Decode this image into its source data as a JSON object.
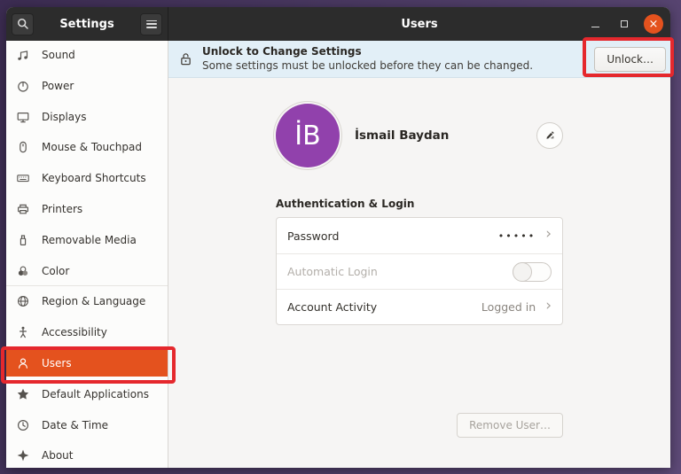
{
  "titlebar": {
    "app_title": "Settings",
    "page_title": "Users",
    "close_glyph": "×"
  },
  "sidebar": {
    "items": [
      {
        "label": "Sound",
        "icon": "sound-icon"
      },
      {
        "label": "Power",
        "icon": "power-icon"
      },
      {
        "label": "Displays",
        "icon": "displays-icon"
      },
      {
        "label": "Mouse & Touchpad",
        "icon": "mouse-icon"
      },
      {
        "label": "Keyboard Shortcuts",
        "icon": "keyboard-icon"
      },
      {
        "label": "Printers",
        "icon": "printer-icon"
      },
      {
        "label": "Removable Media",
        "icon": "removable-media-icon"
      },
      {
        "label": "Color",
        "icon": "color-icon"
      },
      {
        "label": "Region & Language",
        "icon": "globe-icon",
        "separator_before": true
      },
      {
        "label": "Accessibility",
        "icon": "accessibility-icon"
      },
      {
        "label": "Users",
        "icon": "users-icon",
        "selected": true,
        "highlighted": true
      },
      {
        "label": "Default Applications",
        "icon": "star-icon"
      },
      {
        "label": "Date & Time",
        "icon": "clock-icon"
      },
      {
        "label": "About",
        "icon": "four-point-star-icon"
      }
    ]
  },
  "banner": {
    "title": "Unlock to Change Settings",
    "subtitle": "Some settings must be unlocked before they can be changed.",
    "unlock_label": "Unlock…",
    "icon": "lock-icon",
    "highlighted": "unlock_button"
  },
  "user": {
    "initials": "İB",
    "name": "İsmail Baydan"
  },
  "auth": {
    "section_title": "Authentication & Login",
    "rows": [
      {
        "label": "Password",
        "value": "•••••",
        "chevron": "›",
        "type": "navigation"
      },
      {
        "label": "Automatic Login",
        "type": "toggle",
        "state": "off",
        "disabled": true
      },
      {
        "label": "Account Activity",
        "value": "Logged in",
        "chevron": "›",
        "type": "navigation"
      }
    ]
  },
  "actions": {
    "remove_user_label": "Remove User…"
  },
  "icons": {
    "search": "magnifier",
    "menu": "hamburger",
    "minimize": "thin-bar",
    "maximize": "square-outline",
    "close": "circle-x",
    "edit": "pencil",
    "lock": "padlock",
    "chevron": "›",
    "toggle": "switch-off"
  },
  "colors": {
    "header_bg": "#2c2c2c",
    "accent_orange": "#e4521e",
    "close_button": "#e4521e",
    "banner_bg": "#e2eff7",
    "avatar_purple": "#9141ac",
    "annotation_red": "#e5282d"
  }
}
